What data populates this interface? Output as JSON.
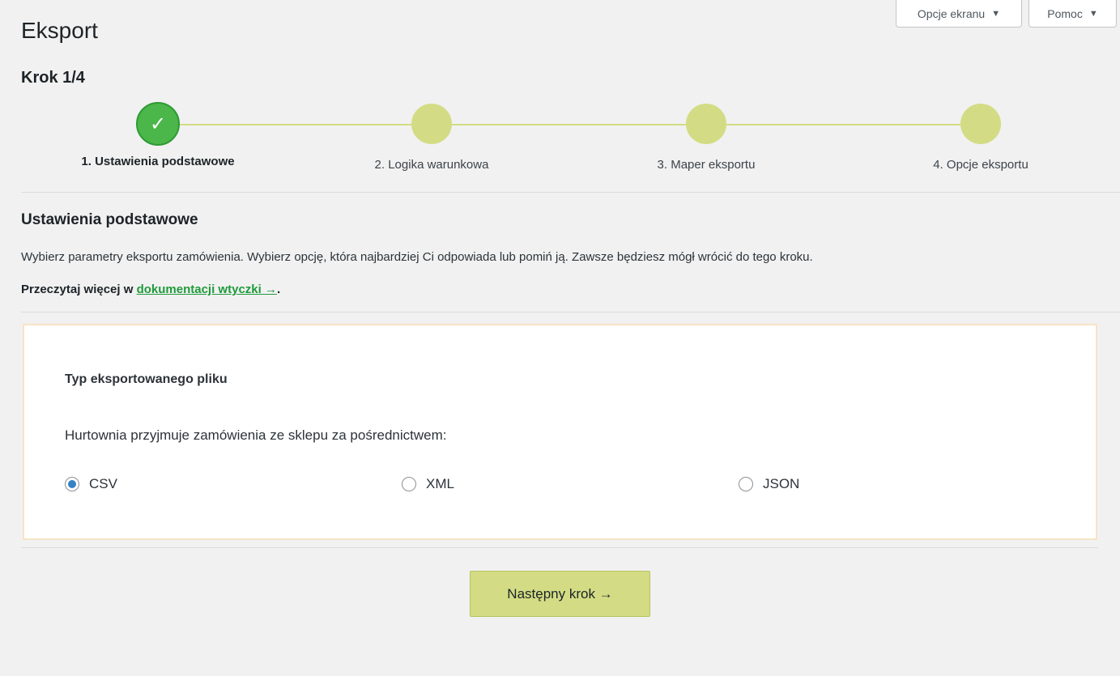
{
  "screen_meta": {
    "screen_options_label": "Opcje ekranu",
    "help_label": "Pomoc"
  },
  "page": {
    "title": "Eksport",
    "step_heading": "Krok 1/4"
  },
  "stepper": {
    "steps": [
      {
        "label": "1. Ustawienia podstawowe",
        "state": "done"
      },
      {
        "label": "2. Logika warunkowa",
        "state": "todo"
      },
      {
        "label": "3. Maper eksportu",
        "state": "todo"
      },
      {
        "label": "4. Opcje eksportu",
        "state": "todo"
      }
    ],
    "check_glyph": "✓"
  },
  "section": {
    "title": "Ustawienia podstawowe",
    "description": "Wybierz parametry eksportu zamówienia. Wybierz opcję, która najbardziej Ci odpowiada lub pomiń ją. Zawsze będziesz mógł wrócić do tego kroku.",
    "read_more_prefix": "Przeczytaj więcej w ",
    "read_more_link": "dokumentacji wtyczki →",
    "read_more_suffix": "."
  },
  "card": {
    "title": "Typ eksportowanego pliku",
    "question": "Hurtownia przyjmuje zamówienia ze sklepu za pośrednictwem:",
    "options": [
      {
        "label": "CSV",
        "checked": true
      },
      {
        "label": "XML",
        "checked": false
      },
      {
        "label": "JSON",
        "checked": false
      }
    ]
  },
  "actions": {
    "next_label": "Następny krok →"
  },
  "colors": {
    "accent_green": "#d3dc84",
    "done_green": "#4bb64a",
    "link_green": "#1f9a3b",
    "radio_blue": "#3582c4"
  }
}
